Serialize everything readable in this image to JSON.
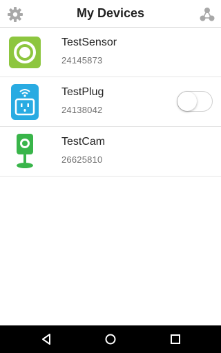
{
  "header": {
    "title": "My Devices",
    "left_icon": "gear-icon",
    "right_icon": "network-icon"
  },
  "devices": [
    {
      "name": "TestSensor",
      "id": "24145873",
      "icon": "sensor-icon",
      "color": "#8dc63f"
    },
    {
      "name": "TestPlug",
      "id": "24138042",
      "icon": "plug-icon",
      "color": "#29abe2",
      "toggle_on": false
    },
    {
      "name": "TestCam",
      "id": "26625810",
      "icon": "camera-icon",
      "color": "#39b54a"
    }
  ],
  "navbar": {
    "back_icon": "back-icon",
    "home_icon": "home-icon",
    "recent_icon": "recent-apps-icon"
  },
  "colors": {
    "header_icon": "#a8a8a8",
    "navbar_bg": "#000000",
    "navbar_icon": "#ffffff"
  }
}
